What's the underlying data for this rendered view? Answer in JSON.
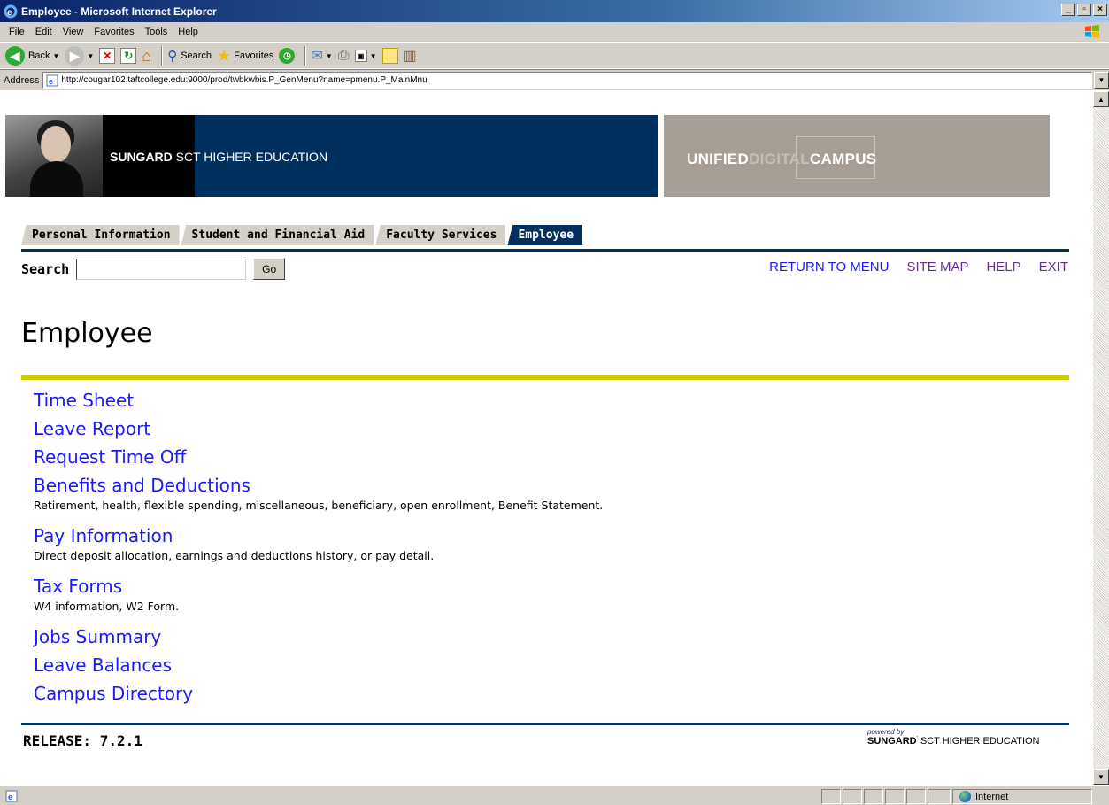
{
  "window": {
    "title": "Employee - Microsoft Internet Explorer"
  },
  "menubar": {
    "items": [
      "File",
      "Edit",
      "View",
      "Favorites",
      "Tools",
      "Help"
    ]
  },
  "toolbar": {
    "back_label": "Back",
    "search_label": "Search",
    "favorites_label": "Favorites"
  },
  "address": {
    "label": "Address",
    "url": "http://cougar102.taftcollege.edu:9000/prod/twbkwbis.P_GenMenu?name=pmenu.P_MainMnu"
  },
  "banner": {
    "brand_bold": "SUNGARD",
    "brand_rest": "SCT HIGHER EDUCATION",
    "udc_1": "UNIFIED",
    "udc_2": "DIGITAL",
    "udc_3": "CAMPUS"
  },
  "tabs": [
    {
      "label": "Personal Information",
      "active": false
    },
    {
      "label": "Student and Financial Aid",
      "active": false
    },
    {
      "label": "Faculty Services",
      "active": false
    },
    {
      "label": "Employee",
      "active": true
    }
  ],
  "search": {
    "label": "Search",
    "value": "",
    "go_label": "Go"
  },
  "toplinks": [
    "RETURN TO MENU",
    "SITE MAP",
    "HELP",
    "EXIT"
  ],
  "page": {
    "title": "Employee"
  },
  "menu": [
    {
      "label": "Time Sheet",
      "desc": ""
    },
    {
      "label": "Leave Report",
      "desc": ""
    },
    {
      "label": "Request Time Off",
      "desc": ""
    },
    {
      "label": "Benefits and Deductions",
      "desc": "Retirement, health, flexible spending, miscellaneous, beneficiary, open enrollment, Benefit Statement."
    },
    {
      "label": "Pay Information",
      "desc": "Direct deposit allocation, earnings and deductions history, or pay detail."
    },
    {
      "label": "Tax Forms",
      "desc": "W4 information, W2 Form."
    },
    {
      "label": "Jobs Summary",
      "desc": ""
    },
    {
      "label": "Leave Balances",
      "desc": ""
    },
    {
      "label": "Campus Directory",
      "desc": ""
    }
  ],
  "footer": {
    "release": "RELEASE: 7.2.1",
    "powered_by": "powered by",
    "brand_bold": "SUNGARD",
    "brand_rest": "SCT HIGHER EDUCATION"
  },
  "status": {
    "zone": "Internet"
  },
  "colors": {
    "navy": "#00305e",
    "gold": "#cccc00",
    "link": "#1a1aff",
    "visited": "#6b2c9a",
    "taupe": "#a69d94"
  }
}
